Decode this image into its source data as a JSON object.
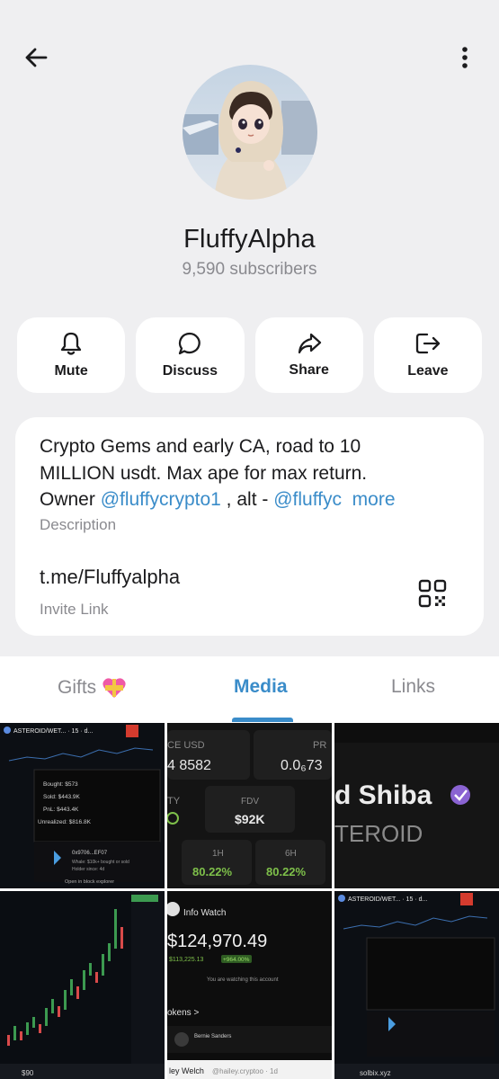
{
  "header": {
    "back_icon": "arrow-left-icon",
    "menu_icon": "more-vertical-icon"
  },
  "channel": {
    "name": "FluffyAlpha",
    "subscribers": "9,590 subscribers"
  },
  "actions": [
    {
      "label": "Mute",
      "icon": "bell-icon"
    },
    {
      "label": "Discuss",
      "icon": "chat-bubble-icon"
    },
    {
      "label": "Share",
      "icon": "share-arrow-icon"
    },
    {
      "label": "Leave",
      "icon": "leave-icon"
    }
  ],
  "info": {
    "description_line1": "Crypto Gems and early CA, road to 10",
    "description_line2": "MILLION usdt. Max ape for max return.",
    "description_owner": "Owner ",
    "description_mention1": "@fluffycrypto1",
    "description_alt": " , alt - ",
    "description_mention2": "@fluffyc",
    "more": "more",
    "description_label": "Description",
    "invite_link": "t.me/Fluffyalpha",
    "invite_label": "Invite Link"
  },
  "tabs": [
    {
      "label": "Gifts",
      "active": false
    },
    {
      "label": "Media",
      "active": true
    },
    {
      "label": "Links",
      "active": false
    }
  ],
  "media": {
    "cell1": {
      "title": "ASTEROID/WET... · 15 · d...",
      "bought": "Bought: $573",
      "sold": "Sold: $443.9K",
      "pnl": "PnL: $443.4K",
      "unrealized": "Unrealized: $816.8K",
      "wallet": "0x9706...EF07",
      "whale": "Whale: $10k+ bought or sold",
      "holder": "Holder since: 4d",
      "explorer": "Open in block explorer"
    },
    "cell2": {
      "price_label": "CE USD",
      "price": "4 8582",
      "value": "0.0₆73",
      "pr": "PR",
      "fdv_label": "FDV",
      "fdv": "$92K",
      "ty": "TY",
      "h1_label": "1H",
      "h6_label": "6H",
      "h1": "80.22%",
      "h6": "80.22%"
    },
    "cell3": {
      "title": "d Shiba",
      "subtitle": "TEROID"
    },
    "cell4": {
      "footer": "$90"
    },
    "cell5": {
      "header": "Info Watch",
      "balance": "$124,970.49",
      "change": "$113,225.13",
      "pct": "+964.00%",
      "watching": "You are watching this account",
      "tokens": "okens >",
      "holder": "Bernie Sanders",
      "footer_name": "ley Welch",
      "footer_handle": "@hailey.cryptoo · 1d"
    },
    "cell6": {
      "title": "ASTEROID/WET... · 15 · d...",
      "footer": "solbix.xyz"
    }
  },
  "colors": {
    "accent": "#3a8cc9",
    "background": "#efeff1",
    "card": "#ffffff",
    "muted": "#8a8a8f",
    "positive": "#7ec04a"
  }
}
